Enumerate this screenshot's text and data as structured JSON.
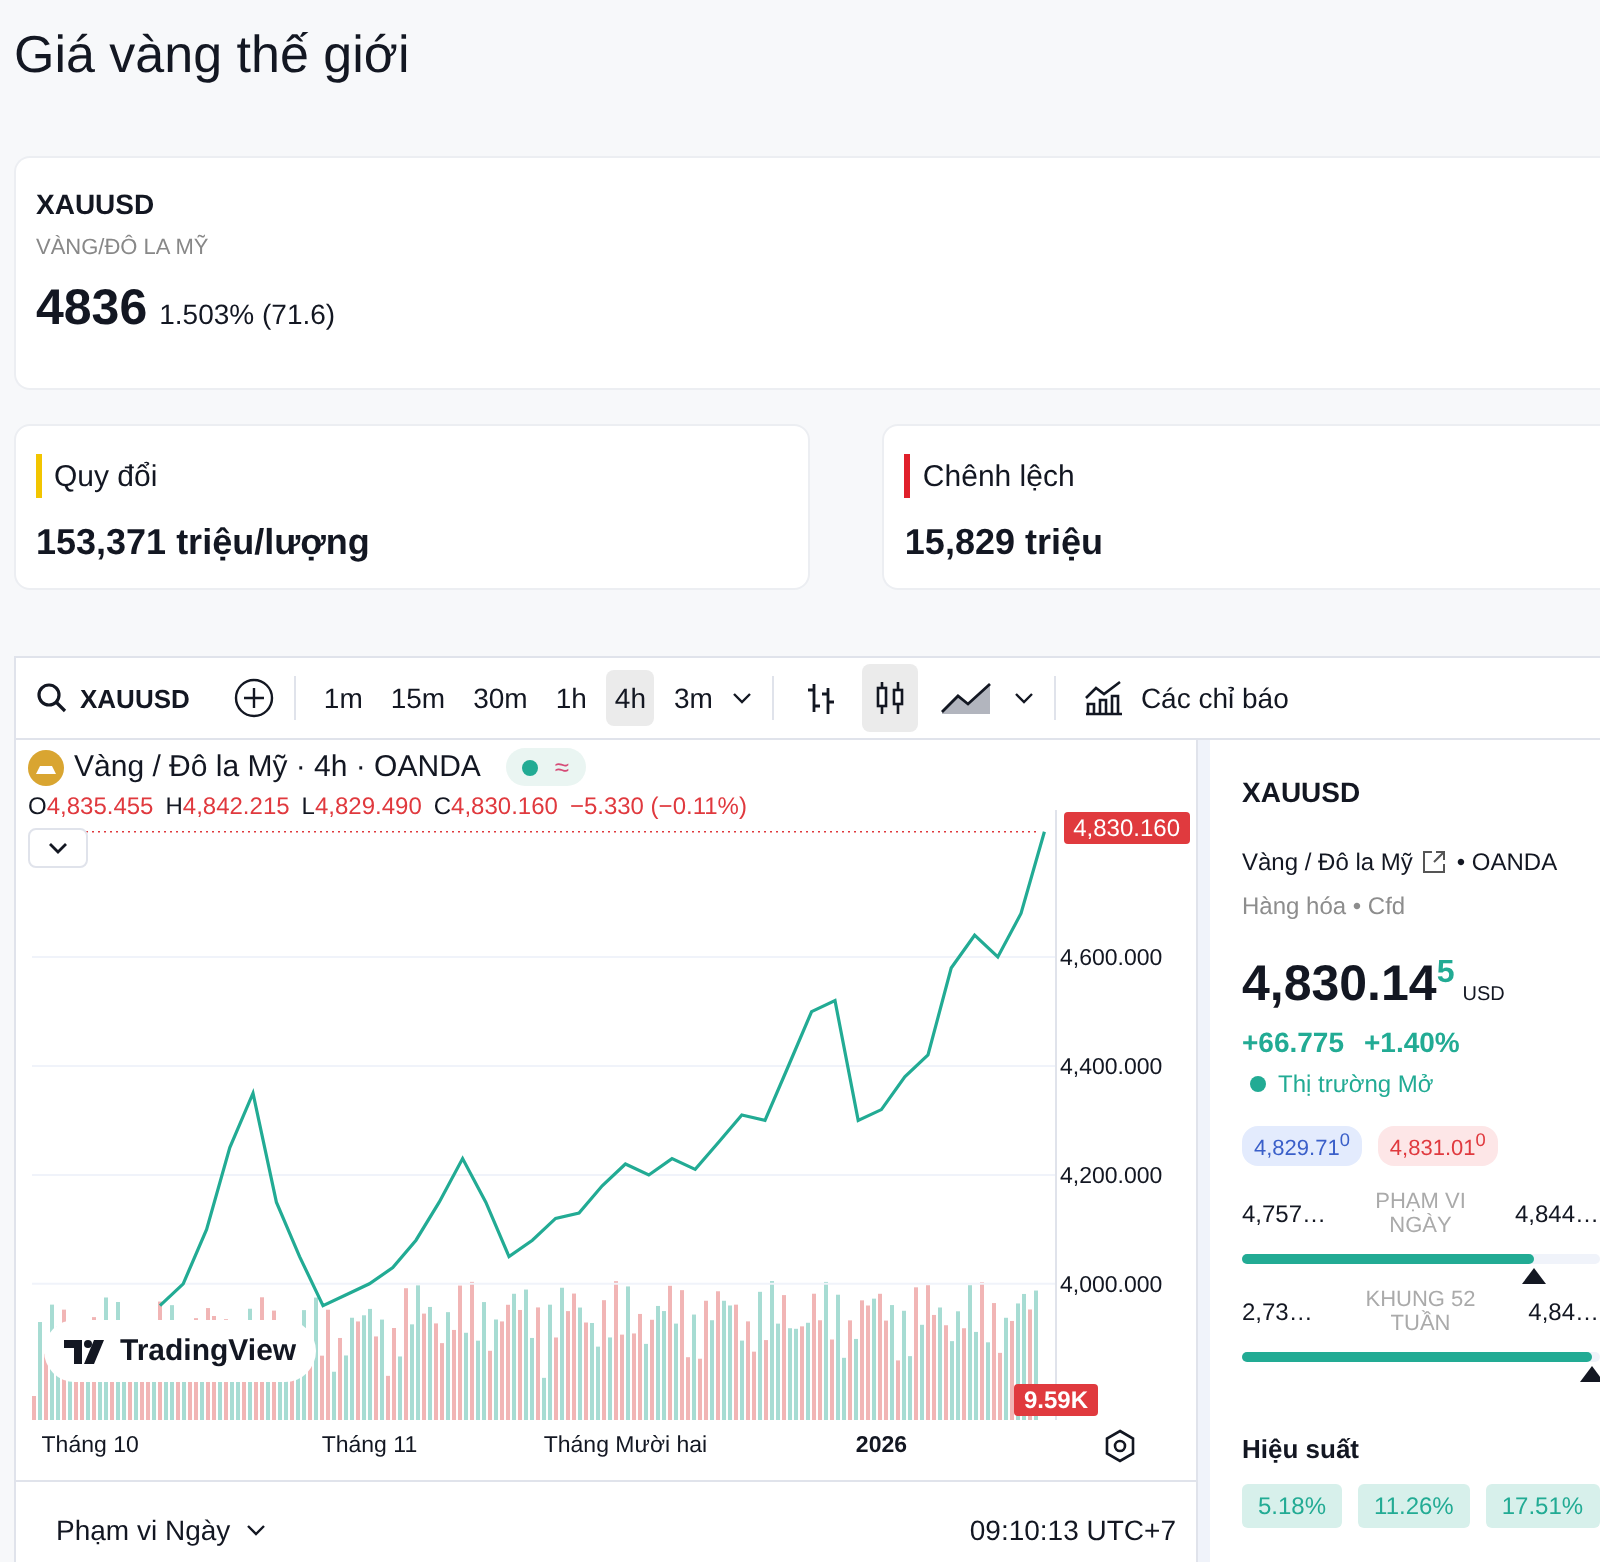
{
  "page_title": "Giá vàng thế giới",
  "quote_card": {
    "symbol": "XAUUSD",
    "subtitle": "VÀNG/ĐÔ LA MỸ",
    "price": "4836",
    "change": "1.503% (71.6)"
  },
  "info_cards": [
    {
      "label": "Quy đổi",
      "value": "153,371 triệu/lượng",
      "color": "#f2c500"
    },
    {
      "label": "Chênh lệch",
      "value": "15,829 triệu",
      "color": "#e0202b"
    }
  ],
  "toolbar": {
    "symbol": "XAUUSD",
    "intervals": [
      {
        "label": "1m",
        "selected": false
      },
      {
        "label": "15m",
        "selected": false
      },
      {
        "label": "30m",
        "selected": false
      },
      {
        "label": "1h",
        "selected": false
      },
      {
        "label": "4h",
        "selected": true
      },
      {
        "label": "3m",
        "selected": false
      }
    ],
    "chart_types": [
      {
        "kind": "bars",
        "selected": false
      },
      {
        "kind": "candles",
        "selected": true
      },
      {
        "kind": "area",
        "selected": false
      }
    ],
    "indicators": "Các chỉ báo"
  },
  "legend": {
    "title": "Vàng / Đô la Mỹ · 4h · OANDA",
    "status": "≈",
    "ohlc": [
      {
        "key": "O",
        "value": "4,835.455"
      },
      {
        "key": "H",
        "value": "4,842.215"
      },
      {
        "key": "L",
        "value": "4,829.490"
      },
      {
        "key": "C",
        "value": "4,830.160"
      }
    ],
    "change": "−5.330 (−0.11%)"
  },
  "price_tag": "4,830.160",
  "volume_tag": "9.59K",
  "logo": "TradingView",
  "chart_data": {
    "type": "line",
    "categories": [
      null,
      null,
      "Tháng 10",
      null,
      null,
      null,
      null,
      null,
      null,
      null,
      null,
      null,
      null,
      null,
      "Tháng 11",
      null,
      null,
      null,
      null,
      null,
      null,
      null,
      null,
      null,
      null,
      "Tháng Mười hai",
      null,
      null,
      null,
      null,
      null,
      null,
      null,
      null,
      null,
      null,
      "2026",
      null,
      null,
      null,
      null,
      null,
      null,
      null
    ],
    "series": [
      {
        "color": "#22ab94",
        "values": [
          null,
          null,
          null,
          null,
          null,
          3960,
          4000,
          4100,
          4250,
          4350,
          4150,
          4050,
          3960,
          3980,
          4000,
          4030,
          4080,
          4150,
          4230,
          4150,
          4050,
          4080,
          4120,
          4130,
          4180,
          4220,
          4200,
          4230,
          4210,
          4260,
          4310,
          4300,
          4400,
          4500,
          4520,
          4300,
          4320,
          4380,
          4420,
          4580,
          4640,
          4600,
          4680,
          4830
        ]
      }
    ],
    "grid": true,
    "ylim": [
      3750,
      4870
    ],
    "ref_lines": [
      {
        "axis": "y",
        "value": 4830,
        "color": "#e03a3e"
      }
    ],
    "yticks": [
      {
        "value": 4600,
        "label": "4,600.000"
      },
      {
        "value": 4400,
        "label": "4,400.000"
      },
      {
        "value": 4200,
        "label": "4,200.000"
      },
      {
        "value": 4000,
        "label": "4,000.000"
      }
    ]
  },
  "range_select": "Phạm vi Ngày",
  "clock": "09:10:13 UTC+7",
  "side": {
    "symbol": "XAUUSD",
    "name": "Vàng / Đô la Mỹ",
    "exchange": "• OANDA",
    "category": "Hàng hóa • Cfd",
    "price": "4,830.14",
    "price_last": "5",
    "currency": "USD",
    "change": "+66.775",
    "change_pct": "+1.40%",
    "market": "Thị trường Mở",
    "bid": "4,829.71$^{0}$",
    "ask": "4,831.01$^{0}$",
    "ranges": [
      {
        "low": "4,757…",
        "label": "PHẠM VI NGÀY",
        "high": "4,844…",
        "level": 0.82
      },
      {
        "low": "2,73…",
        "label": "KHUNG 52 TUẦN",
        "high": "4,84…",
        "level": 0.98
      }
    ],
    "performance_title": "Hiệu suất",
    "performance": [
      "5.18%",
      "11.26%",
      "17.51%"
    ]
  }
}
